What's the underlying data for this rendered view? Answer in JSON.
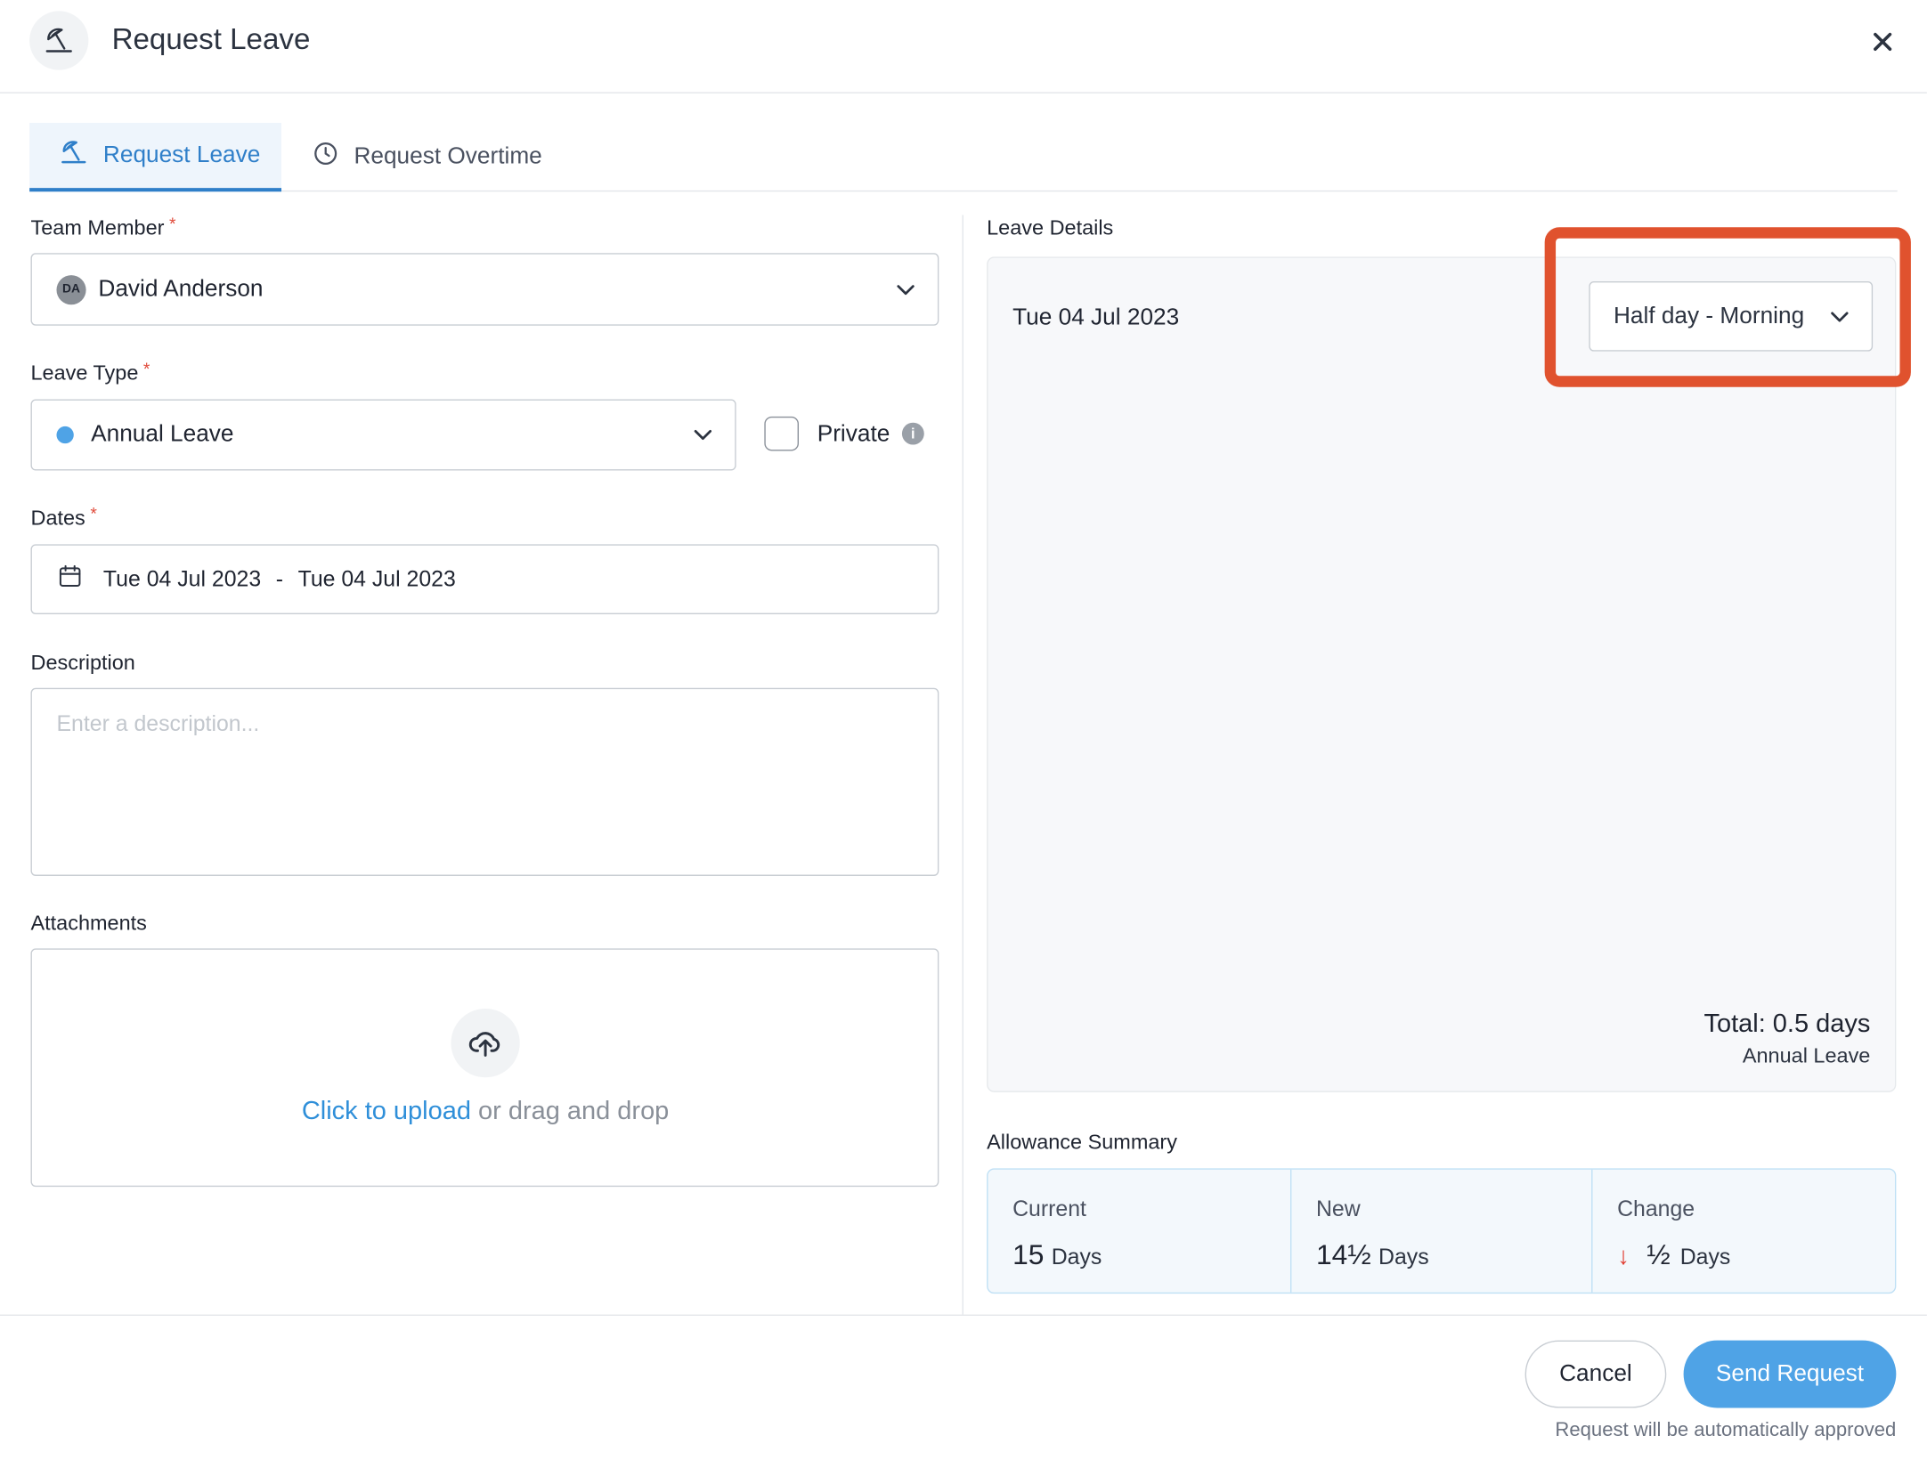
{
  "header": {
    "title": "Request Leave",
    "icon": "beach-umbrella-icon",
    "close_icon": "close-icon"
  },
  "tabs": [
    {
      "label": "Request Leave",
      "icon": "beach-umbrella-icon",
      "active": true
    },
    {
      "label": "Request Overtime",
      "icon": "clock-icon",
      "active": false
    }
  ],
  "form": {
    "team_member": {
      "label": "Team Member",
      "required_mark": "*",
      "avatar_initials": "DA",
      "value": "David Anderson"
    },
    "leave_type": {
      "label": "Leave Type",
      "required_mark": "*",
      "value": "Annual Leave",
      "dot_color": "#4fa3e6"
    },
    "private": {
      "label": "Private",
      "checked": false,
      "info_glyph": "i"
    },
    "dates": {
      "label": "Dates",
      "required_mark": "*",
      "start": "Tue 04 Jul 2023",
      "separator": "-",
      "end": "Tue 04 Jul 2023"
    },
    "description": {
      "label": "Description",
      "placeholder": "Enter a description..."
    },
    "attachments": {
      "label": "Attachments",
      "link_text": "Click to upload",
      "rest_text": " or drag and drop"
    }
  },
  "leave_details": {
    "label": "Leave Details",
    "date": "Tue 04 Jul 2023",
    "period": "Half day - Morning",
    "total": "Total: 0.5 days",
    "total_type": "Annual Leave",
    "highlight_color": "#e0522e"
  },
  "allowance": {
    "label": "Allowance Summary",
    "columns": [
      {
        "head": "Current",
        "value": "15",
        "unit": "Days"
      },
      {
        "head": "New",
        "value": "14½",
        "unit": "Days"
      },
      {
        "head": "Change",
        "value": "½",
        "unit": "Days",
        "arrow": "↓"
      }
    ]
  },
  "footer": {
    "cancel_label": "Cancel",
    "send_label": "Send Request",
    "note": "Request will be automatically approved",
    "accent_color": "#4fa3e6"
  }
}
